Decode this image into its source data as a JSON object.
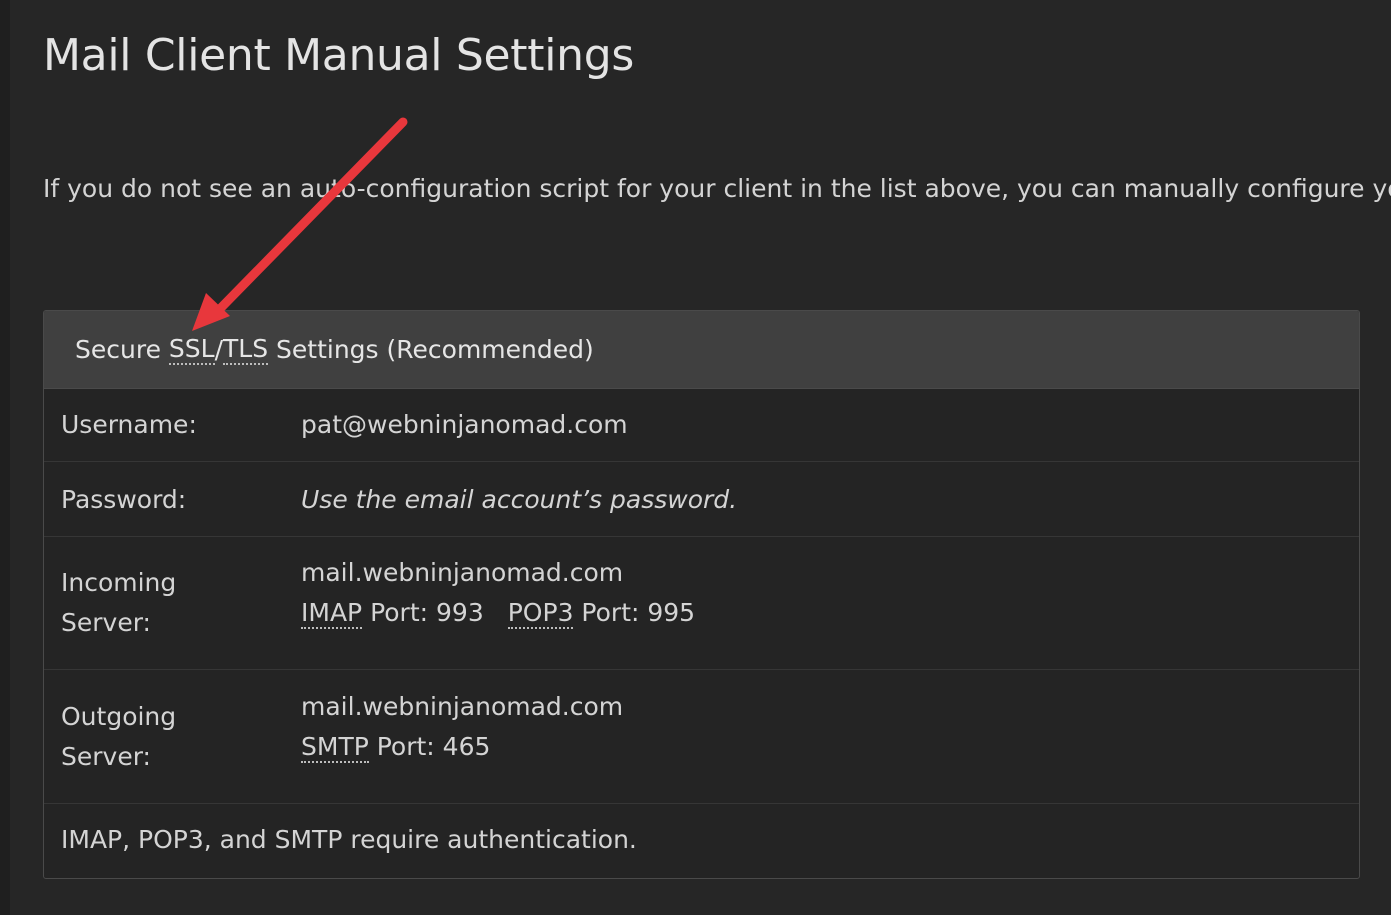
{
  "page": {
    "title": "Mail Client Manual Settings",
    "intro": "If you do not see an auto-configuration script for your client in the list above, you can manually configure yo"
  },
  "panel": {
    "heading": {
      "prefix": "Secure ",
      "ssl": "SSL",
      "slash": "/",
      "tls": "TLS",
      "suffix": " Settings (Recommended)"
    },
    "username": {
      "label": "Username:",
      "value": "pat@webninjanomad.com"
    },
    "password": {
      "label": "Password:",
      "value": "Use the email account’s password."
    },
    "incoming": {
      "label_line1": "Incoming",
      "label_line2": "Server:",
      "host": "mail.webninjanomad.com",
      "imap_abbr": "IMAP",
      "imap_port": " Port: 993",
      "pop3_abbr": "POP3",
      "pop3_port": " Port: 995"
    },
    "outgoing": {
      "label_line1": "Outgoing",
      "label_line2": "Server:",
      "host": "mail.webninjanomad.com",
      "smtp_abbr": "SMTP",
      "smtp_port": " Port: 465"
    },
    "note": "IMAP, POP3, and SMTP require authentication."
  },
  "annotation": {
    "arrow_color": "#e8373c"
  },
  "colors": {
    "background": "#262626",
    "panel_heading": "#404040",
    "text": "#d4d4d4"
  }
}
